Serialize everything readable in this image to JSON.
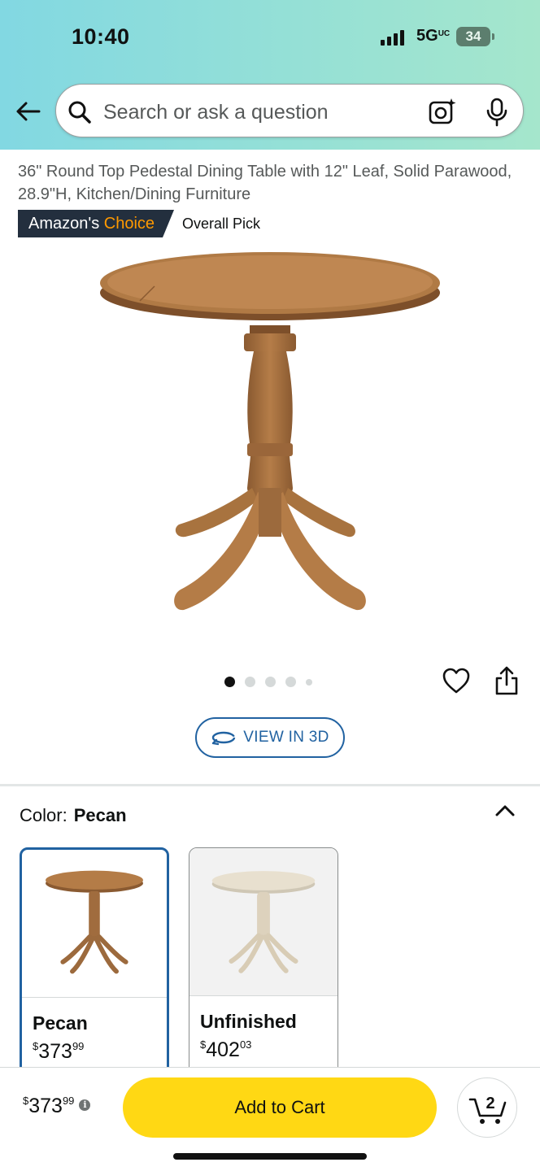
{
  "status_bar": {
    "time": "10:40",
    "network": "5G",
    "battery": "34"
  },
  "header": {
    "search_placeholder": "Search or ask a question",
    "icons": [
      "back-arrow-icon",
      "search-icon",
      "camera-lens-icon",
      "microphone-icon"
    ]
  },
  "product": {
    "title": "36\" Round Top Pedestal Dining Table with 12\" Leaf, Solid Parawood, 28.9\"H, Kitchen/Dining Furniture",
    "badge_prefix": "Amazon's",
    "badge_highlight": "Choice",
    "badge_sub": "Overall Pick",
    "image_dots": 5,
    "active_dot": 1,
    "view_3d": "VIEW IN 3D"
  },
  "color_selector": {
    "label": "Color:",
    "selected": "Pecan",
    "options": [
      {
        "name": "Pecan",
        "price_currency": "$",
        "price_whole": "373",
        "price_fraction": "99",
        "selected": true
      },
      {
        "name": "Unfinished",
        "price_currency": "$",
        "price_whole": "402",
        "price_fraction": "03",
        "selected": false
      }
    ]
  },
  "bottom_bar": {
    "price_currency": "$",
    "price_whole": "373",
    "price_fraction": "99",
    "add_to_cart": "Add to Cart",
    "cart_count": "2"
  },
  "colors": {
    "accent_blue": "#2162a1",
    "add_to_cart_yellow": "#ffd814",
    "badge_dark": "#232f3e",
    "badge_orange": "#ff9900"
  }
}
